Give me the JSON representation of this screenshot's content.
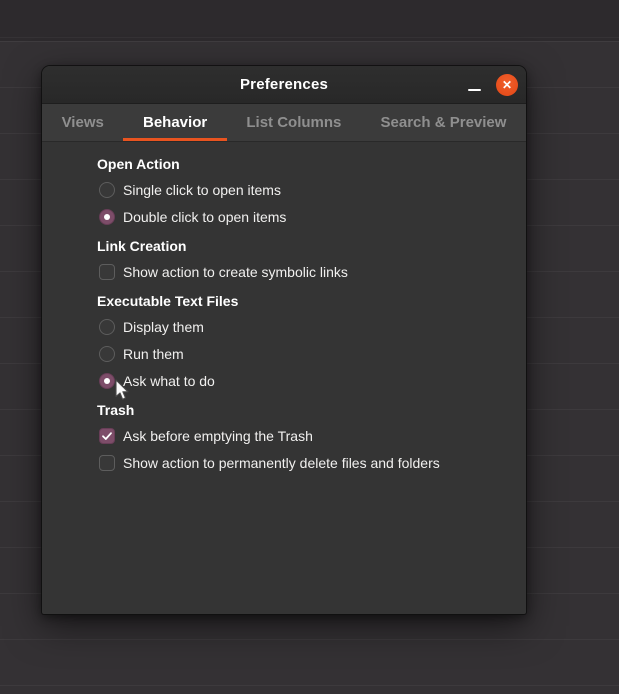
{
  "window": {
    "title": "Preferences"
  },
  "icons": {
    "minimize": "window-minimize-icon",
    "close": "window-close-icon",
    "close_glyph": "✕",
    "checkmark": "check-icon",
    "cursor": "arrow-pointer-icon"
  },
  "colors": {
    "accent_orange": "#E95420",
    "accent_purple": "#7D4D69",
    "titlebar_bg": "#2B2B2B",
    "tabbar_bg": "#3B3B3B",
    "content_bg": "#343434",
    "desktop_bg": "#343134"
  },
  "tabs": [
    {
      "label": "Views",
      "active": false
    },
    {
      "label": "Behavior",
      "active": true
    },
    {
      "label": "List Columns",
      "active": false
    },
    {
      "label": "Search & Preview",
      "active": false
    }
  ],
  "sections": [
    {
      "heading": "Open Action",
      "items": [
        {
          "type": "radio",
          "label": "Single click to open items",
          "checked": false
        },
        {
          "type": "radio",
          "label": "Double click to open items",
          "checked": true
        }
      ]
    },
    {
      "heading": "Link Creation",
      "items": [
        {
          "type": "checkbox",
          "label": "Show action to create symbolic links",
          "checked": false
        }
      ]
    },
    {
      "heading": "Executable Text Files",
      "items": [
        {
          "type": "radio",
          "label": "Display them",
          "checked": false
        },
        {
          "type": "radio",
          "label": "Run them",
          "checked": false
        },
        {
          "type": "radio",
          "label": "Ask what to do",
          "checked": true
        }
      ]
    },
    {
      "heading": "Trash",
      "items": [
        {
          "type": "checkbox",
          "label": "Ask before emptying the Trash",
          "checked": true
        },
        {
          "type": "checkbox",
          "label": "Show action to permanently delete files and folders",
          "checked": false
        }
      ]
    }
  ]
}
